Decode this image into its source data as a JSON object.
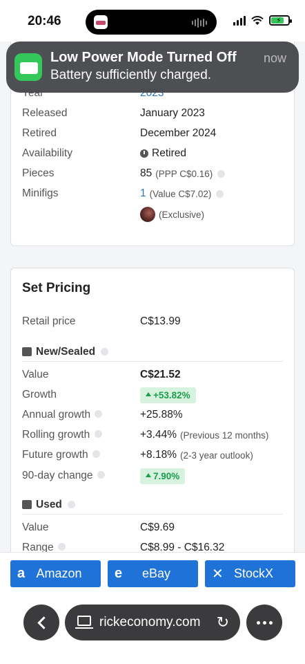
{
  "status": {
    "time": "20:46"
  },
  "notification": {
    "title": "Low Power Mode Turned Off",
    "body": "Battery sufficiently charged.",
    "time": "now"
  },
  "details": {
    "rows": [
      {
        "label": "Year",
        "value": "2023"
      },
      {
        "label": "Released",
        "value": "January 2023"
      },
      {
        "label": "Retired",
        "value": "December 2024"
      },
      {
        "label": "Availability",
        "value": "Retired"
      },
      {
        "label": "Pieces",
        "value": "85",
        "note": "(PPP C$0.16)"
      },
      {
        "label": "Minifigs",
        "value": "1",
        "note": "(Value C$7.02)"
      }
    ],
    "exclusive_label": "(Exclusive)"
  },
  "pricing": {
    "title": "Set Pricing",
    "retail": {
      "label": "Retail price",
      "value": "C$13.99"
    },
    "new_sealed": {
      "heading": "New/Sealed",
      "value": {
        "label": "Value",
        "value": "C$21.52"
      },
      "growth": {
        "label": "Growth",
        "value": "+53.82%"
      },
      "annual": {
        "label": "Annual growth",
        "value": "+25.88%"
      },
      "rolling": {
        "label": "Rolling growth",
        "value": "+3.44%",
        "note": "(Previous 12 months)"
      },
      "future": {
        "label": "Future growth",
        "value": "+8.18%",
        "note": "(2-3 year outlook)"
      },
      "change90": {
        "label": "90-day change",
        "value": "7.90%"
      }
    },
    "used": {
      "heading": "Used",
      "value": {
        "label": "Value",
        "value": "C$9.69"
      },
      "range": {
        "label": "Range",
        "value": "C$8.99 - C$16.32"
      }
    }
  },
  "stores": {
    "amazon": {
      "icon": "a",
      "label": "Amazon"
    },
    "ebay": {
      "icon": "e",
      "label": "eBay"
    },
    "stockx": {
      "icon": "✕",
      "label": "StockX"
    }
  },
  "browser": {
    "url": "rickeconomy.com"
  },
  "colors": {
    "accent": "#1f73d8",
    "positive": "#1b9d4d",
    "positive_bg": "#d7f2df",
    "link": "#2a74c4"
  }
}
